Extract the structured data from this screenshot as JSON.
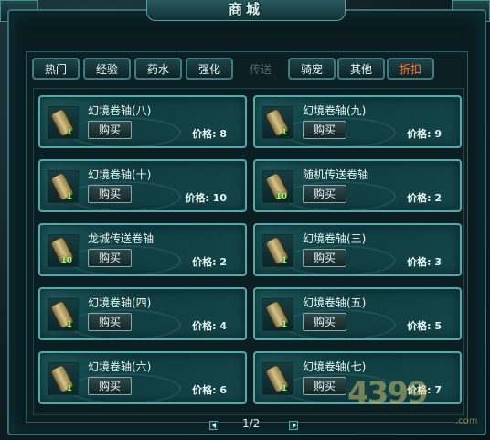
{
  "window": {
    "title": "商城"
  },
  "tabs": [
    {
      "label": "热门",
      "state": "normal"
    },
    {
      "label": "经验",
      "state": "normal"
    },
    {
      "label": "药水",
      "state": "normal"
    },
    {
      "label": "强化",
      "state": "normal"
    },
    {
      "label": "传送",
      "state": "disabled"
    },
    {
      "label": "骑宠",
      "state": "normal"
    },
    {
      "label": "其他",
      "state": "normal"
    },
    {
      "label": "折扣",
      "state": "highlight"
    }
  ],
  "items": [
    {
      "name": "幻境卷轴(八)",
      "qty": "1",
      "buy_label": "购买",
      "price": "价格: 8"
    },
    {
      "name": "幻境卷轴(九)",
      "qty": "1",
      "buy_label": "购买",
      "price": "价格: 9"
    },
    {
      "name": "幻境卷轴(十)",
      "qty": "1",
      "buy_label": "购买",
      "price": "价格: 10"
    },
    {
      "name": "随机传送卷轴",
      "qty": "10",
      "buy_label": "购买",
      "price": "价格: 2"
    },
    {
      "name": "龙城传送卷轴",
      "qty": "10",
      "buy_label": "购买",
      "price": "价格: 2"
    },
    {
      "name": "幻境卷轴(三)",
      "qty": "1",
      "buy_label": "购买",
      "price": "价格: 3"
    },
    {
      "name": "幻境卷轴(四)",
      "qty": "1",
      "buy_label": "购买",
      "price": "价格: 4"
    },
    {
      "name": "幻境卷轴(五)",
      "qty": "1",
      "buy_label": "购买",
      "price": "价格: 5"
    },
    {
      "name": "幻境卷轴(六)",
      "qty": "1",
      "buy_label": "购买",
      "price": "价格: 6"
    },
    {
      "name": "幻境卷轴(七)",
      "qty": "1",
      "buy_label": "购买",
      "price": "价格: 7"
    }
  ],
  "pagination": {
    "text": "1/2"
  },
  "watermark": {
    "text": "4399",
    "suffix": ".com"
  },
  "colors": {
    "accent": "#55a9ac",
    "discount_tab": "#ff7e3a",
    "qty": "#8fff6e"
  }
}
